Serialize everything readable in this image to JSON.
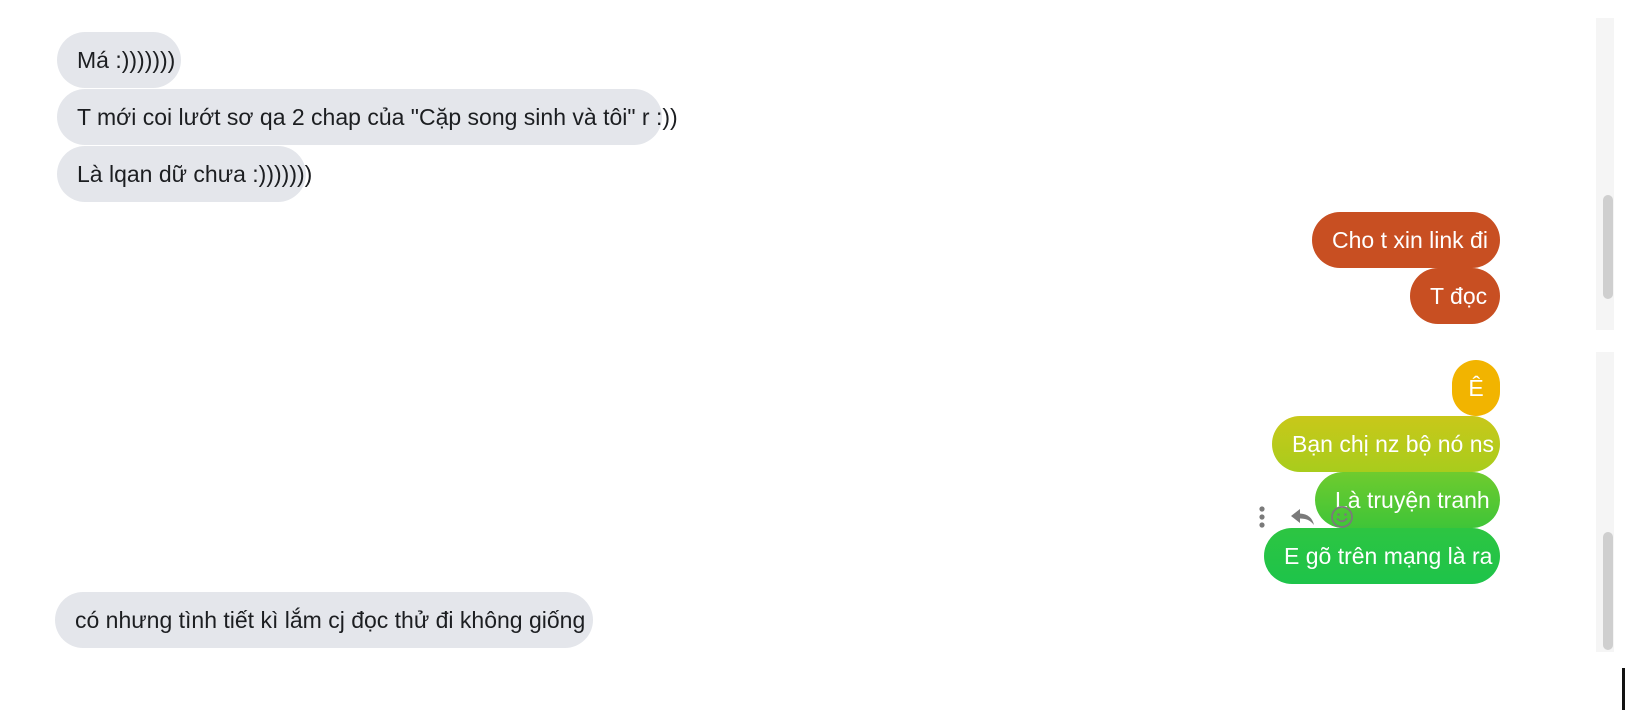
{
  "messages": {
    "received_top": [
      "Má :)))))))",
      "T mới coi lướt sơ qa 2 chap của \"Cặp song sinh và tôi\" r :))",
      "Là lqan dữ chưa :)))))))"
    ],
    "sent_group_1": [
      "Cho t xin link đi",
      "T đọc"
    ],
    "sent_group_2": [
      "Ê",
      "Bạn chị nz bộ nó ns",
      "Là truyện tranh",
      "E gõ trên mạng là ra"
    ],
    "received_bottom": [
      "có nhưng tình tiết kì lắm cj đọc thử đi không giống"
    ]
  },
  "icons": {
    "more": "more-vertical-icon",
    "reply": "reply-icon",
    "react": "smiley-icon"
  },
  "colors": {
    "incoming_bubble": "#e4e6eb",
    "outgoing_orange": "#c84f22",
    "gradient_yellow": "#f2b400",
    "gradient_green": "#1ec44a"
  }
}
